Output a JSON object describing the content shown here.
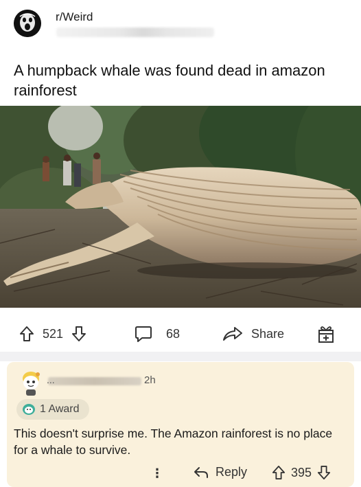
{
  "post": {
    "subreddit": "r/Weird",
    "title": "A humpback whale was found dead in amazon rainforest"
  },
  "actions": {
    "upvotes": "521",
    "comments": "68",
    "share_label": "Share"
  },
  "comment": {
    "time": "2h",
    "username_prefix": "...",
    "award_label": "1 Award",
    "body": "This doesn't surprise me. The Amazon rainforest is no place for a whale to survive.",
    "more_label": "⋮",
    "reply_label": "Reply",
    "score": "395"
  },
  "colors": {
    "comment_bg": "#faf1dc",
    "divider": "#f1f1f3"
  }
}
